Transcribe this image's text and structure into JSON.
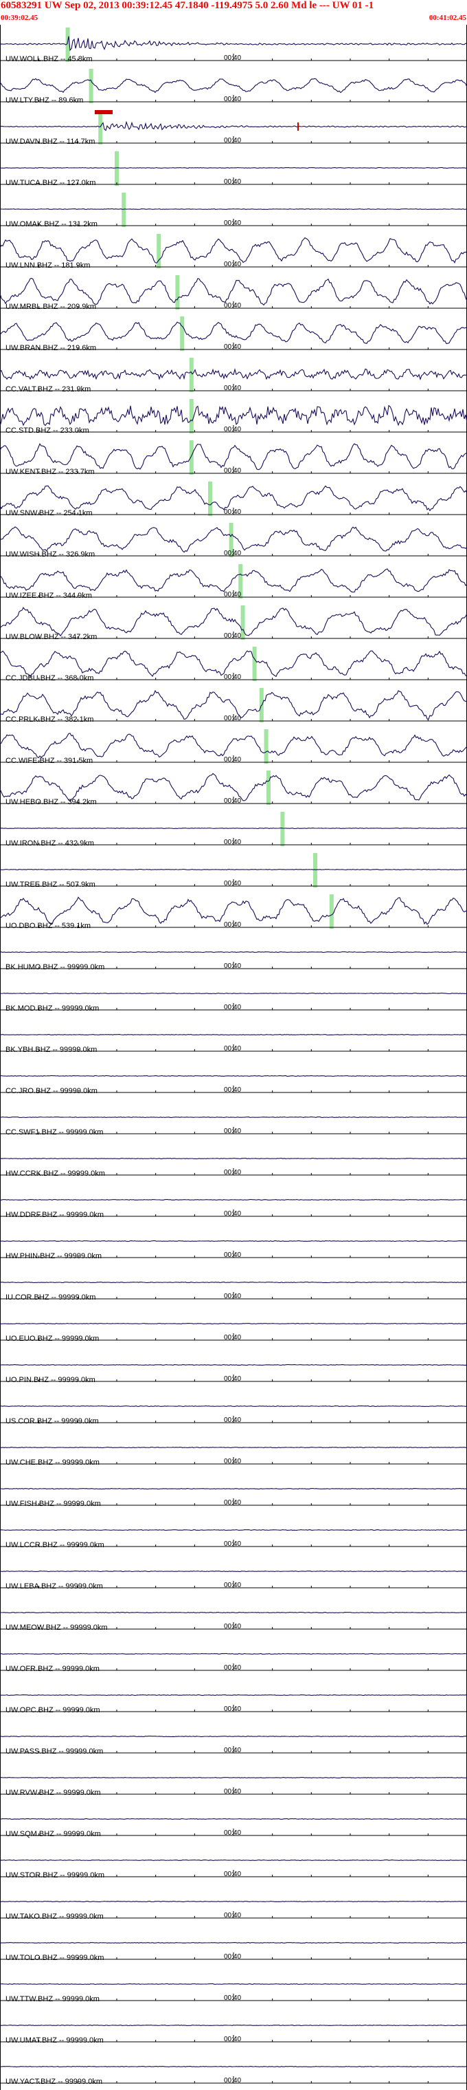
{
  "header": {
    "title": "60583291 UW Sep 02, 2013 00:39:12.45    47.1840  -119.4975   5.0  2.60  Md  le ---  UW 01   -1",
    "start_time": "00:39:02.45",
    "end_time": "00:41:02.45",
    "color": "#ff0000"
  },
  "minute_tick_label": "00:40",
  "colors": {
    "trace": "#1a0a5c",
    "pick": "#90e090",
    "axis": "#000000",
    "marker": "#cc0000"
  },
  "stations": [
    {
      "label": "UW.WOLL.BHZ -- 45.8km",
      "amp": 0.45,
      "type": "quake",
      "pick": 0.145
    },
    {
      "label": "UW.LTY.BHZ -- 89.6km",
      "amp": 0.4,
      "type": "wave",
      "pick": 0.195
    },
    {
      "label": "UW.DAVN.BHZ -- 114.7km",
      "amp": 0.35,
      "type": "quake",
      "pick": 0.215
    },
    {
      "label": "UW.TUCA.BHZ -- 127.0km",
      "amp": 0.0,
      "type": "flat",
      "pick": 0.25
    },
    {
      "label": "UW.OMAK.BHZ -- 131.2km",
      "amp": 0.0,
      "type": "flat",
      "pick": 0.265
    },
    {
      "label": "UW.LNN.BHZ -- 181.9km",
      "amp": 0.7,
      "type": "wave",
      "pick": 0.34
    },
    {
      "label": "UW.MRBL.BHZ -- 209.9km",
      "amp": 0.75,
      "type": "wave",
      "pick": 0.38
    },
    {
      "label": "UW.BRAN.BHZ -- 219.6km",
      "amp": 0.6,
      "type": "wave",
      "pick": 0.39
    },
    {
      "label": "CC.VALT.BHZ -- 231.9km",
      "amp": 0.3,
      "type": "noisy",
      "pick": 0.41
    },
    {
      "label": "CC.STD.BHZ -- 233.0km",
      "amp": 0.6,
      "type": "noisy",
      "pick": 0.41
    },
    {
      "label": "UW.KENT.BHZ -- 233.7km",
      "amp": 0.75,
      "type": "wave",
      "pick": 0.41
    },
    {
      "label": "UW.SNW.BHZ -- 254.1km",
      "amp": 0.7,
      "type": "wave",
      "pick": 0.45
    },
    {
      "label": "UW.WISH.BHZ -- 326.9km",
      "amp": 0.7,
      "type": "wave",
      "pick": 0.495
    },
    {
      "label": "UW.IZEE.BHZ -- 344.9km",
      "amp": 0.7,
      "type": "wave",
      "pick": 0.515
    },
    {
      "label": "UW.BLOW.BHZ -- 347.2km",
      "amp": 0.8,
      "type": "wave",
      "pick": 0.52
    },
    {
      "label": "CC.JDBU.BHZ -- 368.0km",
      "amp": 0.75,
      "type": "wave",
      "pick": 0.545
    },
    {
      "label": "CC.PRLK.BHZ -- 382.1km",
      "amp": 0.8,
      "type": "wave",
      "pick": 0.56
    },
    {
      "label": "CC.WIFE.BHZ -- 391.5km",
      "amp": 0.7,
      "type": "wave",
      "pick": 0.57
    },
    {
      "label": "UW.HEBO.BHZ -- 394.2km",
      "amp": 0.75,
      "type": "wave",
      "pick": 0.575
    },
    {
      "label": "UW.IRON.BHZ -- 432.9km",
      "amp": 0.0,
      "type": "flat",
      "pick": 0.605
    },
    {
      "label": "UW.TREE.BHZ -- 507.9km",
      "amp": 0.0,
      "type": "flat",
      "pick": 0.675
    },
    {
      "label": "UO.DBO.BHZ -- 539.1km",
      "amp": 0.75,
      "type": "wave",
      "pick": 0.71
    },
    {
      "label": "BK.HUMO.BHZ -- 99999.0km",
      "amp": 0.0,
      "type": "flat",
      "pick": null
    },
    {
      "label": "BK.MOD.BHZ -- 99999.0km",
      "amp": 0.0,
      "type": "flat",
      "pick": null
    },
    {
      "label": "BK.YBH.BHZ -- 99999.0km",
      "amp": 0.0,
      "type": "flat",
      "pick": null
    },
    {
      "label": "CC.JRO.BHZ -- 99999.0km",
      "amp": 0.0,
      "type": "flat",
      "pick": null
    },
    {
      "label": "CC.SWF1.BHZ -- 99999.0km",
      "amp": 0.0,
      "type": "flat",
      "pick": null
    },
    {
      "label": "HW.CCRK.BHZ -- 99999.0km",
      "amp": 0.0,
      "type": "flat",
      "pick": null
    },
    {
      "label": "HW.DDRF.BHZ -- 99999.0km",
      "amp": 0.0,
      "type": "flat",
      "pick": null
    },
    {
      "label": "HW.PHIN.BHZ -- 99999.0km",
      "amp": 0.0,
      "type": "flat",
      "pick": null
    },
    {
      "label": "IU.COR.BHZ -- 99999.0km",
      "amp": 0.0,
      "type": "flat",
      "pick": null
    },
    {
      "label": "UO.EUO.BHZ -- 99999.0km",
      "amp": 0.0,
      "type": "flat",
      "pick": null
    },
    {
      "label": "UO.PIN.BHZ -- 99999.0km",
      "amp": 0.0,
      "type": "flat",
      "pick": null
    },
    {
      "label": "US.COR.BHZ -- 99999.0km",
      "amp": 0.0,
      "type": "flat",
      "pick": null
    },
    {
      "label": "UW.CHE.BHZ -- 99999.0km",
      "amp": 0.0,
      "type": "flat",
      "pick": null
    },
    {
      "label": "UW.FISH.BHZ -- 99999.0km",
      "amp": 0.0,
      "type": "flat",
      "pick": null
    },
    {
      "label": "UW.LCCR.BHZ -- 99999.0km",
      "amp": 0.0,
      "type": "flat",
      "pick": null
    },
    {
      "label": "UW.LEBA.BHZ -- 99999.0km",
      "amp": 0.0,
      "type": "flat",
      "pick": null
    },
    {
      "label": "UW.MEOW.BHZ -- 99999.0km",
      "amp": 0.0,
      "type": "flat",
      "pick": null
    },
    {
      "label": "UW.OFR.BHZ -- 99999.0km",
      "amp": 0.0,
      "type": "flat",
      "pick": null
    },
    {
      "label": "UW.OPC.BHZ -- 99999.0km",
      "amp": 0.0,
      "type": "flat",
      "pick": null
    },
    {
      "label": "UW.PASS.BHZ -- 99999.0km",
      "amp": 0.0,
      "type": "flat",
      "pick": null
    },
    {
      "label": "UW.RVW.BHZ -- 99999.0km",
      "amp": 0.0,
      "type": "flat",
      "pick": null
    },
    {
      "label": "UW.SQM.BHZ -- 99999.0km",
      "amp": 0.0,
      "type": "flat",
      "pick": null
    },
    {
      "label": "UW.STOR.BHZ -- 99999.0km",
      "amp": 0.0,
      "type": "flat",
      "pick": null
    },
    {
      "label": "UW.TAKO.BHZ -- 99999.0km",
      "amp": 0.0,
      "type": "flat",
      "pick": null
    },
    {
      "label": "UW.TOLO.BHZ -- 99999.0km",
      "amp": 0.0,
      "type": "flat",
      "pick": null
    },
    {
      "label": "UW.TTW.BHZ -- 99999.0km",
      "amp": 0.0,
      "type": "flat",
      "pick": null
    },
    {
      "label": "UW.UMAT.BHZ -- 99999.0km",
      "amp": 0.0,
      "type": "flat",
      "pick": null
    },
    {
      "label": "UW.YACT.BHZ -- 99999.0km",
      "amp": 0.0,
      "type": "flat",
      "pick": null
    }
  ]
}
